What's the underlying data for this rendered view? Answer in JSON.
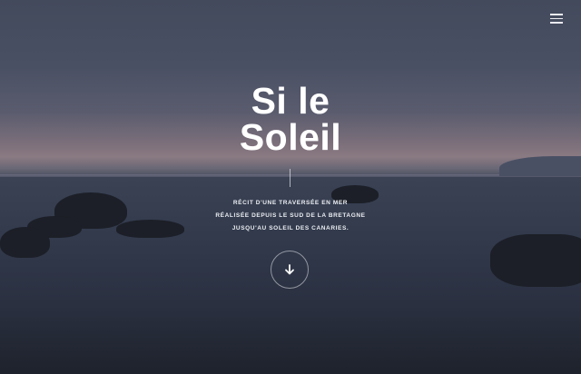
{
  "header": {
    "menu_icon": "hamburger-menu-icon"
  },
  "hero": {
    "title_line1": "Si le",
    "title_line2": "Soleil",
    "subtitle_line1": "RÉCIT D'UNE TRAVERSÉE EN MER",
    "subtitle_line2": "RÉALISÉE DEPUIS LE SUD DE LA BRETAGNE",
    "subtitle_line3": "JUSQU'AU SOLEIL DES CANARIES.",
    "scroll_icon": "arrow-down-icon"
  }
}
